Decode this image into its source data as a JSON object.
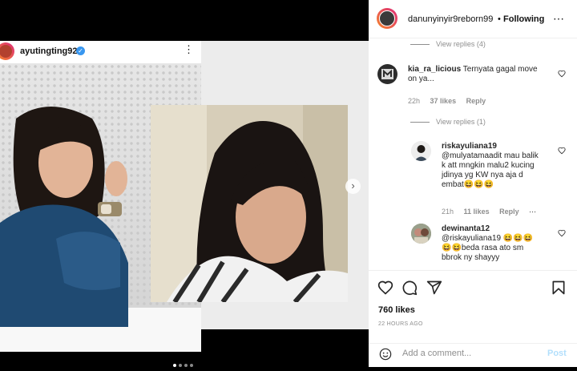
{
  "post": {
    "username": "ayutingting92",
    "verified_glyph": "✓",
    "more_glyph": "⋮",
    "next_glyph": "›",
    "carousel_total": 4,
    "carousel_active": 1
  },
  "panel": {
    "header": {
      "username": "danunyinyir9reborn99",
      "separator": "•",
      "follow_label": "Following",
      "more_glyph": "⋯"
    },
    "comments": [
      {
        "type": "view_replies",
        "label": "View replies (4)"
      },
      {
        "type": "comment",
        "username": "kia_ra_licious",
        "text_lines": [
          "Ternyata gagal move",
          "on ya..."
        ],
        "time": "22h",
        "likes": "37 likes",
        "reply_label": "Reply"
      },
      {
        "type": "view_replies",
        "label": "View replies (1)"
      },
      {
        "type": "reply",
        "username": "riskayuliana19",
        "text_lines": [
          "@mulyatamaadit mau balik",
          "k att mngkin malu2 kucing",
          "jdinya yg KW nya aja d",
          "embat😆😆😆"
        ],
        "time": "21h",
        "likes": "11 likes",
        "reply_label": "Reply",
        "more_glyph": "⋯"
      },
      {
        "type": "reply",
        "username": "dewinanta12",
        "text_lines": [
          "@riskayuliana19 😆😆😆",
          "😆😆beda rasa ato sm",
          "bbrok ny shayyy"
        ]
      }
    ],
    "likes": "760 likes",
    "time": "22 HOURS AGO",
    "add_comment_placeholder": "Add a comment...",
    "post_label": "Post"
  },
  "icons": {
    "like": "heart-icon",
    "comment": "comment-icon",
    "share": "paper-plane-icon",
    "save": "bookmark-icon",
    "emoji": "smiley-icon"
  },
  "colors": {
    "link_blue": "#3897f0",
    "post_disabled": "#b2dffc",
    "muted": "#8e8e8e"
  }
}
